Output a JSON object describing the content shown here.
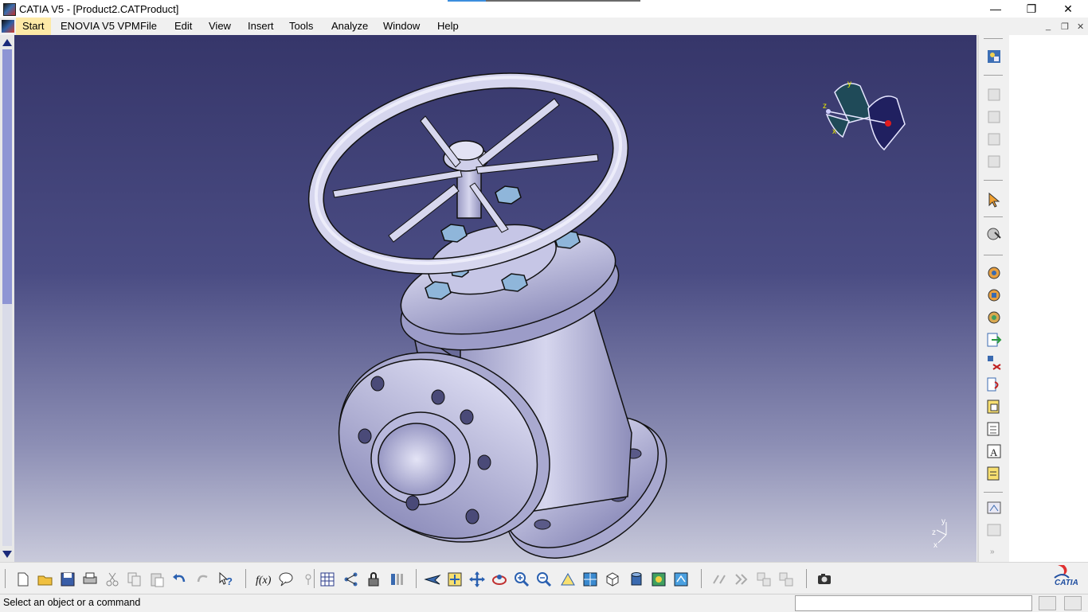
{
  "window": {
    "title": "CATIA V5 - [Product2.CATProduct]",
    "minimize_glyph": "—",
    "maximize_glyph": "❐",
    "close_glyph": "✕"
  },
  "menubar": {
    "items": [
      {
        "label": "Start",
        "active": true
      },
      {
        "label": "ENOVIA V5 VPM"
      },
      {
        "label": "File"
      },
      {
        "label": "Edit"
      },
      {
        "label": "View"
      },
      {
        "label": "Insert"
      },
      {
        "label": "Tools"
      },
      {
        "label": "Analyze"
      },
      {
        "label": "Window"
      },
      {
        "label": "Help"
      }
    ],
    "mdi_controls": [
      "_",
      "❐",
      "✕"
    ]
  },
  "viewport": {
    "background_top": "#36366a",
    "background_bottom": "#c9cadb",
    "model": "valve-assembly",
    "compass_labels": {
      "y": "y",
      "z": "z",
      "x": "x"
    },
    "axis_labels": {
      "y": "y",
      "z": "z",
      "x": "x"
    }
  },
  "right_toolbar": {
    "tools": [
      {
        "icon": "product-structure-icon"
      },
      {
        "icon": "new-component-icon",
        "disabled": true
      },
      {
        "icon": "new-product-icon",
        "disabled": true
      },
      {
        "icon": "new-part-icon",
        "disabled": true
      },
      {
        "icon": "existing-component-icon",
        "disabled": true
      },
      {
        "icon": "select-icon"
      },
      {
        "icon": "manipulation-icon"
      },
      {
        "icon": "constraint-gear-1-icon"
      },
      {
        "icon": "constraint-gear-2-icon"
      },
      {
        "icon": "constraint-gear-3-icon"
      },
      {
        "icon": "export-icon"
      },
      {
        "icon": "replace-icon"
      },
      {
        "icon": "reorder-icon"
      },
      {
        "icon": "generate-numbering-icon"
      },
      {
        "icon": "multi-instantiation-icon"
      },
      {
        "icon": "annotation-text-icon"
      },
      {
        "icon": "bill-of-material-icon"
      },
      {
        "icon": "scene-icon"
      },
      {
        "icon": "scene-disabled-icon",
        "disabled": true
      }
    ]
  },
  "bottom_toolbar": {
    "tools": [
      "new-icon",
      "open-icon",
      "save-icon",
      "print-icon",
      "cut-icon",
      "copy-icon",
      "paste-icon",
      "undo-icon",
      "redo-icon",
      "whats-this-icon",
      "formula-icon",
      "comment-icon",
      "knowledge-icon",
      "table-icon",
      "tree-icon",
      "lock-icon",
      "catalog-icon",
      "fly-mode-icon",
      "fit-all-icon",
      "pan-icon",
      "rotate-icon",
      "zoom-in-icon",
      "zoom-out-icon",
      "normal-view-icon",
      "views-icon",
      "render-style-icon",
      "cylinder-icon",
      "hide-show-icon",
      "swap-space-icon",
      "spec-icon",
      "next-icon",
      "sync-icon",
      "sync2-icon",
      "capture-icon"
    ],
    "logo_text": "CATIA"
  },
  "statusbar": {
    "message": "Select an object or a command",
    "input_value": ""
  }
}
